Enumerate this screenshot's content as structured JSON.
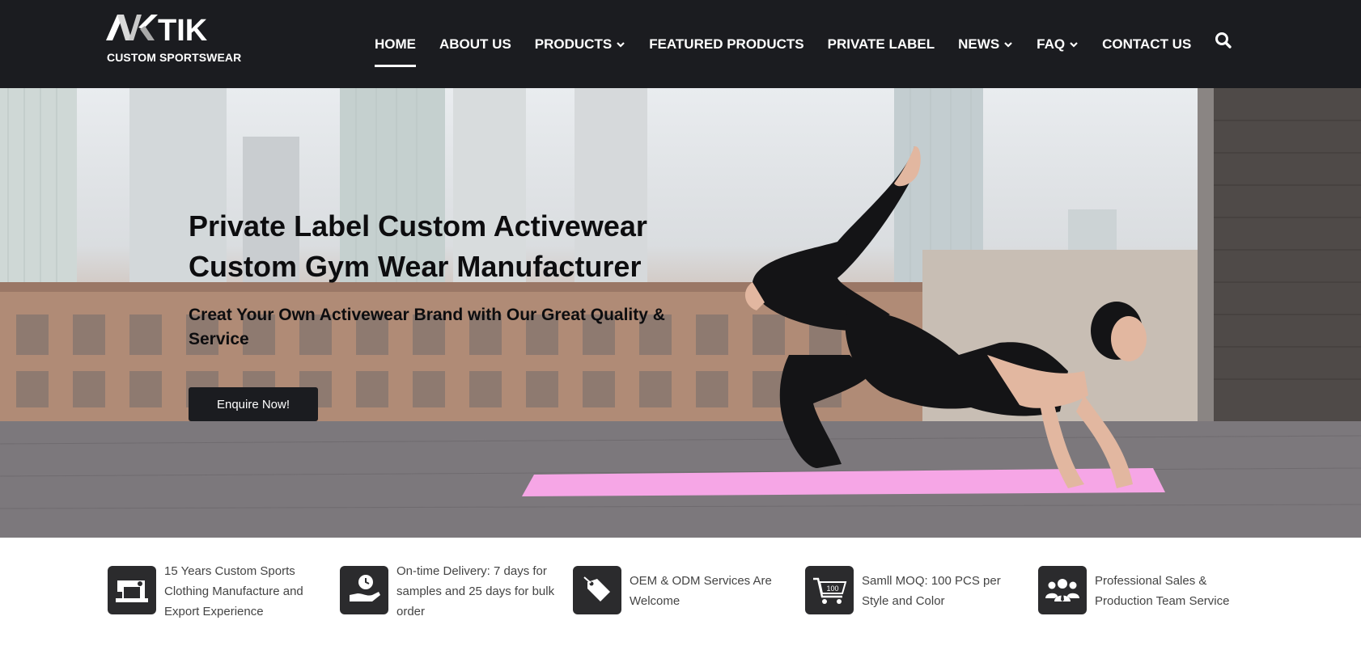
{
  "brand": {
    "logo_text": "AKTIK",
    "tagline": "CUSTOM SPORTSWEAR"
  },
  "nav": {
    "items": [
      {
        "label": "HOME",
        "dropdown": false,
        "active": true
      },
      {
        "label": "ABOUT US",
        "dropdown": false,
        "active": false
      },
      {
        "label": "PRODUCTS",
        "dropdown": true,
        "active": false
      },
      {
        "label": "FEATURED PRODUCTS",
        "dropdown": false,
        "active": false
      },
      {
        "label": "PRIVATE LABEL",
        "dropdown": false,
        "active": false
      },
      {
        "label": "NEWS",
        "dropdown": true,
        "active": false
      },
      {
        "label": "FAQ",
        "dropdown": true,
        "active": false
      },
      {
        "label": "CONTACT US",
        "dropdown": false,
        "active": false
      }
    ],
    "search_icon": "search-icon"
  },
  "hero": {
    "title_line1": "Private Label Custom Activewear",
    "title_line2": "Custom Gym Wear Manufacturer",
    "subtitle": "Creat Your Own Activewear Brand with Our Great Quality & Service",
    "cta_label": "Enquire Now!"
  },
  "features": [
    {
      "icon": "sewing-machine-icon",
      "text": "15 Years Custom Sports Clothing Manufacture and Export Experience"
    },
    {
      "icon": "delivery-clock-icon",
      "text": "On-time Delivery: 7 days for samples and 25 days for bulk order"
    },
    {
      "icon": "price-tag-icon",
      "text": "OEM & ODM Services Are Welcome"
    },
    {
      "icon": "cart-icon",
      "icon_label": "100",
      "text": "Samll MOQ: 100 PCS per Style and Color"
    },
    {
      "icon": "team-icon",
      "text": "Professional Sales & Production Team Service"
    }
  ],
  "colors": {
    "header_bg": "#1b1c20",
    "text_dark": "#0d0d0f",
    "icon_bg": "#2b2b2d",
    "mat_pink": "#f6a6e6",
    "feature_text": "#444444"
  }
}
